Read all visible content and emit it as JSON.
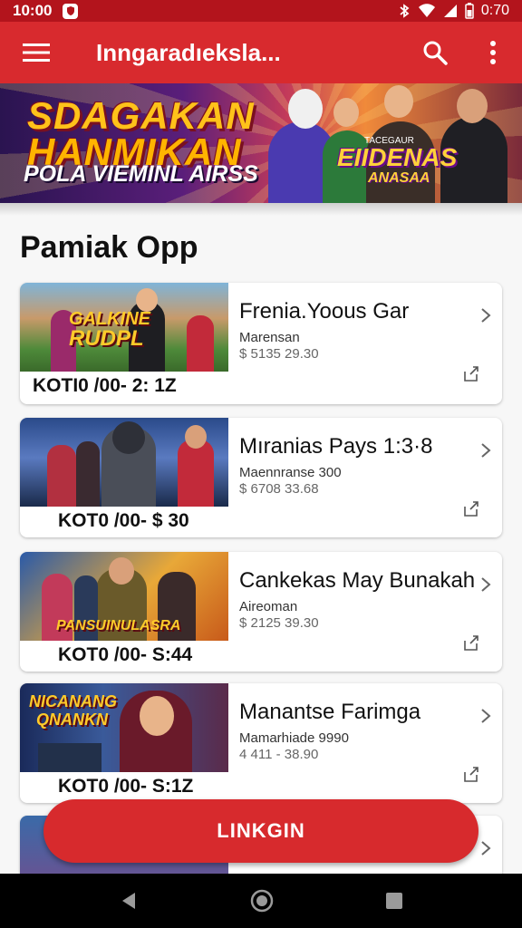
{
  "status_bar": {
    "time": "10:00",
    "battery_text": "0:70"
  },
  "app_bar": {
    "title": "Inngaradıeksla..."
  },
  "banner": {
    "headline_1": "SDAGAKAN",
    "headline_2": "HANMIKAN",
    "subline": "POLA VIEMINL AIRSS",
    "brand_small": "TACEGAUR",
    "brand": "EIIDENAS",
    "brand_sub": "ANASAA"
  },
  "section_title": "Pamiak Opp",
  "cards": [
    {
      "thumb_label_1": "GALKINE",
      "thumb_label_2": "RUDPL",
      "code": "KOTI0 /00- 2: 1Z",
      "name": "Frenia.Yoous Gar",
      "meta": "Marensan",
      "price": "$ 5135 29.30"
    },
    {
      "thumb_label_1": "",
      "thumb_label_2": "",
      "code": "KOT0 /00- $ 30",
      "name": "Mıranias Pays 1:3·8",
      "meta": "Maennranse 300",
      "price": "$ 6708 33.68"
    },
    {
      "thumb_label_1": "PANSUINULASRA",
      "thumb_label_2": "",
      "code": "KOT0 /00- S:44",
      "name": "Cankekas May Bunakah",
      "meta": "Aireoman",
      "price": "$ 2125 39.30"
    },
    {
      "thumb_label_1": "NICANANG",
      "thumb_label_2": "QNANKN",
      "code": "KOT0 /00- S:1Z",
      "name": "Manantse Farimga",
      "meta": "Mamarhiade 9990",
      "price": "4 411 - 38.90"
    }
  ],
  "fab_label": "LINKGIN",
  "colors": {
    "primary": "#d82a2e",
    "status": "#b3141c",
    "accent_yellow": "#ffc21a"
  }
}
